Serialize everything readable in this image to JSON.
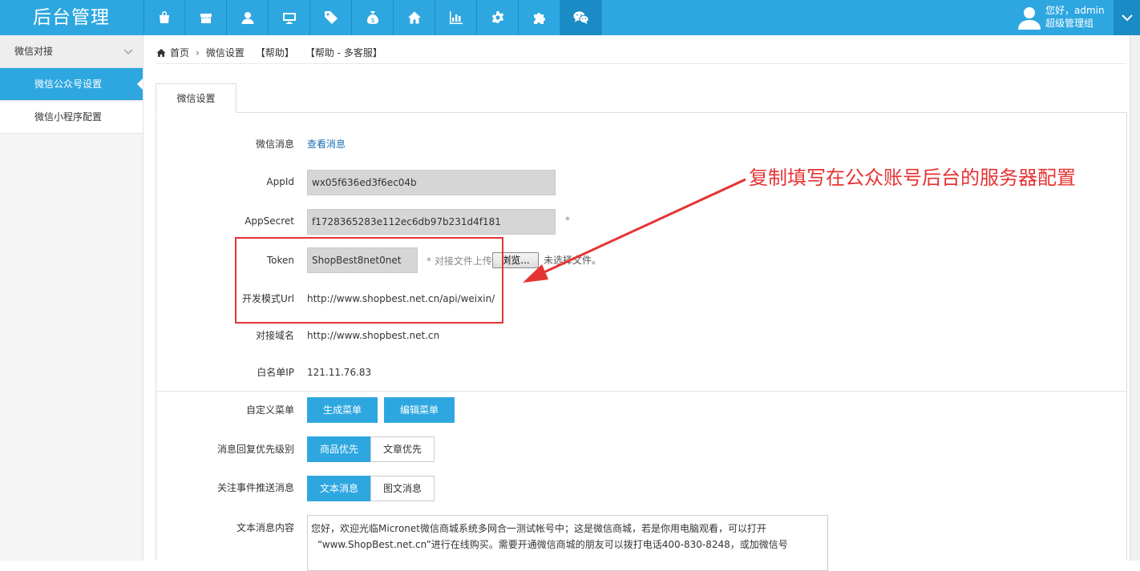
{
  "brand": "后台管理",
  "nav": {
    "icons": [
      "shop-icon",
      "store-icon",
      "user-icon",
      "monitor-icon",
      "tag-icon",
      "money-bag-icon",
      "home-icon",
      "bar-chart-icon",
      "gear-icon",
      "puzzle-icon",
      "wechat-icon"
    ],
    "active_index": 10
  },
  "user": {
    "greeting": "您好，admin",
    "role": "超级管理组"
  },
  "sidebar": {
    "group": "微信对接",
    "items": [
      {
        "label": "微信公众号设置",
        "active": true
      },
      {
        "label": "微信小程序配置",
        "active": false
      }
    ]
  },
  "breadcrumb": {
    "home": "首页",
    "current": "微信设置",
    "help": "【帮助】",
    "help2": "【帮助 - 多客服】"
  },
  "tab": "微信设置",
  "form": {
    "messages_label": "微信消息",
    "messages_link": "查看消息",
    "appid_label": "AppId",
    "appid_value": "wx05f636ed3f6ec04b",
    "appsecret_label": "AppSecret",
    "appsecret_value": "f1728365283e112ec6db97b231d4f181",
    "required_mark": "*",
    "token_label": "Token",
    "token_value": "ShopBest8net0net",
    "upload_hint": "* 对接文件上传",
    "browse_button": "浏览...",
    "no_file": "未选择文件。",
    "url_label": "开发模式Url",
    "url_value": "http://www.shopbest.net.cn/api/weixin/",
    "domain_label": "对接域名",
    "domain_value": "http://www.shopbest.net.cn",
    "whitelist_label": "白名单IP",
    "whitelist_value": "121.11.76.83",
    "menu_label": "自定义菜单",
    "generate_menu": "生成菜单",
    "edit_menu": "编辑菜单",
    "priority_label": "消息回复优先级别",
    "priority_options": [
      "商品优先",
      "文章优先"
    ],
    "follow_label": "关注事件推送消息",
    "follow_options": [
      "文本消息",
      "图文消息"
    ],
    "text_label": "文本消息内容",
    "text_line1": "您好，欢迎光临Micronet微信商城系统多网合一测试帐号中；这是微信商城，若是你用电脑观看，可以打开",
    "text_line2": "“www.ShopBest.net.cn”进行在线购买。需要开通微信商城的朋友可以拨打电话400-830-8248，或加微信号"
  },
  "annotation": "复制填写在公众账号后台的服务器配置",
  "colors": {
    "primary": "#2ea7e0",
    "annotation": "#e53333"
  }
}
